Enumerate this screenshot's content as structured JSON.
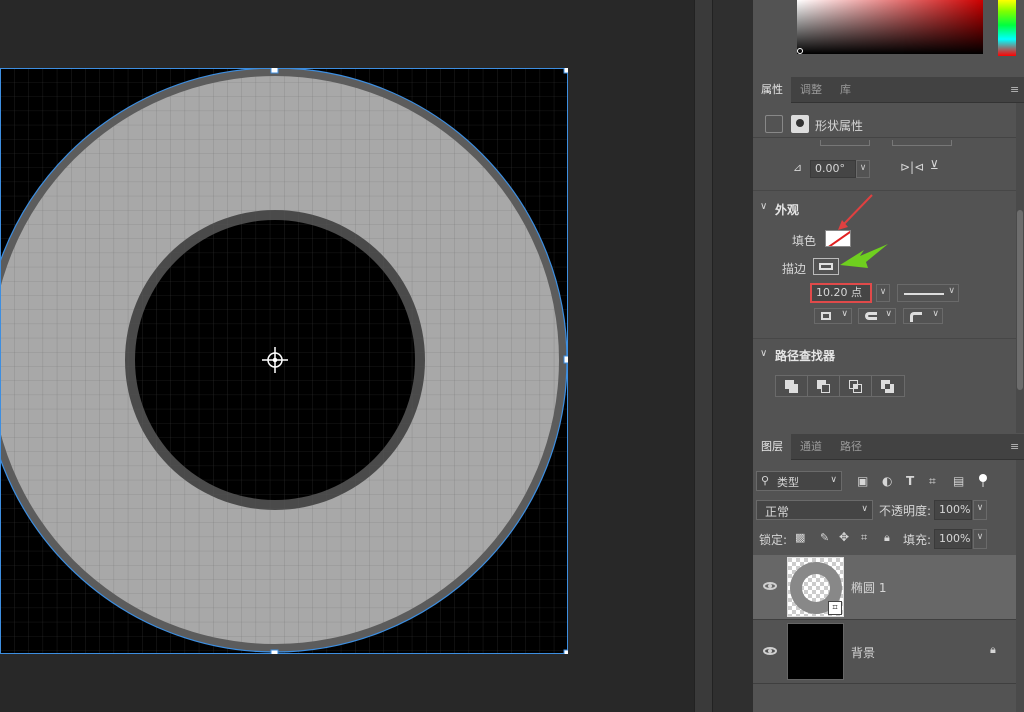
{
  "properties_tabs": [
    {
      "label": "属性",
      "active": true
    },
    {
      "label": "调整",
      "active": false
    },
    {
      "label": "库",
      "active": false
    }
  ],
  "shape_props_title": "形状属性",
  "angle_value": "0.00°",
  "appearance": {
    "section_label": "外观",
    "fill_label": "填色",
    "stroke_label": "描边",
    "stroke_width": "10.20 点"
  },
  "pathfinder_label": "路径查找器",
  "layers_tabs": [
    {
      "label": "图层",
      "active": true
    },
    {
      "label": "通道",
      "active": false
    },
    {
      "label": "路径",
      "active": false
    }
  ],
  "filter_kind": "类型",
  "blend_mode": "正常",
  "opacity_label": "不透明度:",
  "opacity_value": "100%",
  "lock_label": "锁定:",
  "fill_opacity_label": "填充:",
  "fill_opacity_value": "100%",
  "layers": [
    {
      "name": "椭圆 1",
      "selected": true,
      "locked": false
    },
    {
      "name": "背景",
      "selected": false,
      "locked": true
    }
  ],
  "colors": {
    "stroke_annotation_arrow": "#6fcf1f",
    "fill_annotation_arrow": "#e04040",
    "highlight_box": "#e04a4a",
    "bbox_line": "#3d8ee0"
  }
}
